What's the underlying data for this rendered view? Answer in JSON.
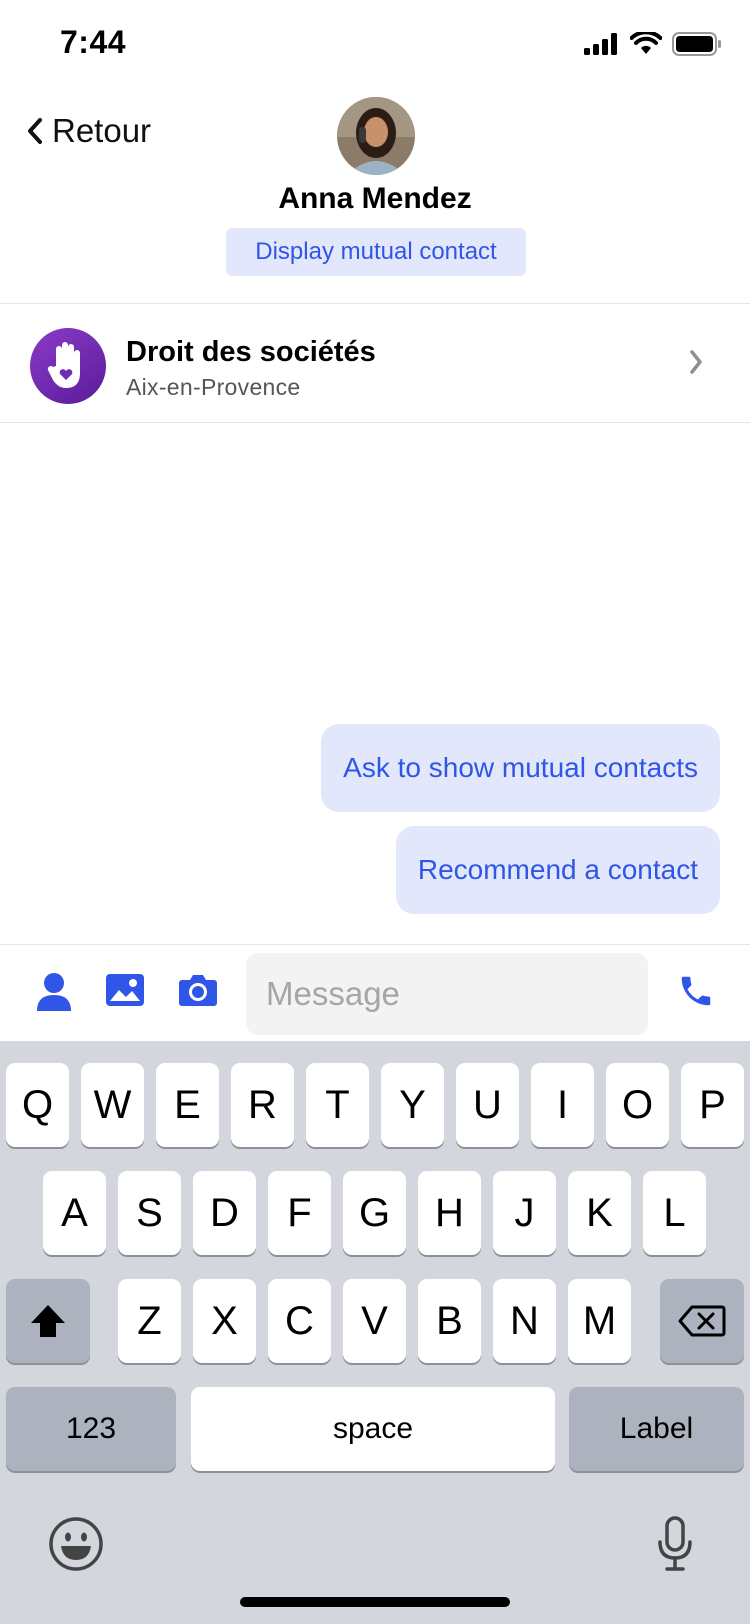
{
  "status_bar": {
    "time": "7:44"
  },
  "header": {
    "back_label": "Retour",
    "contact_name": "Anna Mendez",
    "mutual_button": "Display mutual contact"
  },
  "group": {
    "title": "Droit des sociétés",
    "subtitle": "Aix-en-Provence"
  },
  "suggestions": [
    "Ask to show mutual contacts",
    "Recommend a contact"
  ],
  "composer": {
    "placeholder": "Message"
  },
  "keyboard": {
    "row1": [
      "Q",
      "W",
      "E",
      "R",
      "T",
      "Y",
      "U",
      "I",
      "O",
      "P"
    ],
    "row2": [
      "A",
      "S",
      "D",
      "F",
      "G",
      "H",
      "J",
      "K",
      "L"
    ],
    "row3": [
      "Z",
      "X",
      "C",
      "V",
      "B",
      "N",
      "M"
    ],
    "numbers_label": "123",
    "space_label": "space",
    "return_label": "Label"
  },
  "colors": {
    "accent": "#2f56e6",
    "accent_bg": "#e2e7fb",
    "keyboard_bg": "#d3d6dd",
    "group_logo": "#6f2bb3"
  },
  "icons": {
    "back": "chevron-left-icon",
    "group_logo": "hand-heart-icon",
    "row_chevron": "chevron-right-icon",
    "toolbar": [
      "person-icon",
      "image-icon",
      "camera-icon",
      "phone-icon"
    ],
    "keyboard": [
      "shift-icon",
      "backspace-icon",
      "emoji-icon",
      "microphone-icon"
    ]
  }
}
